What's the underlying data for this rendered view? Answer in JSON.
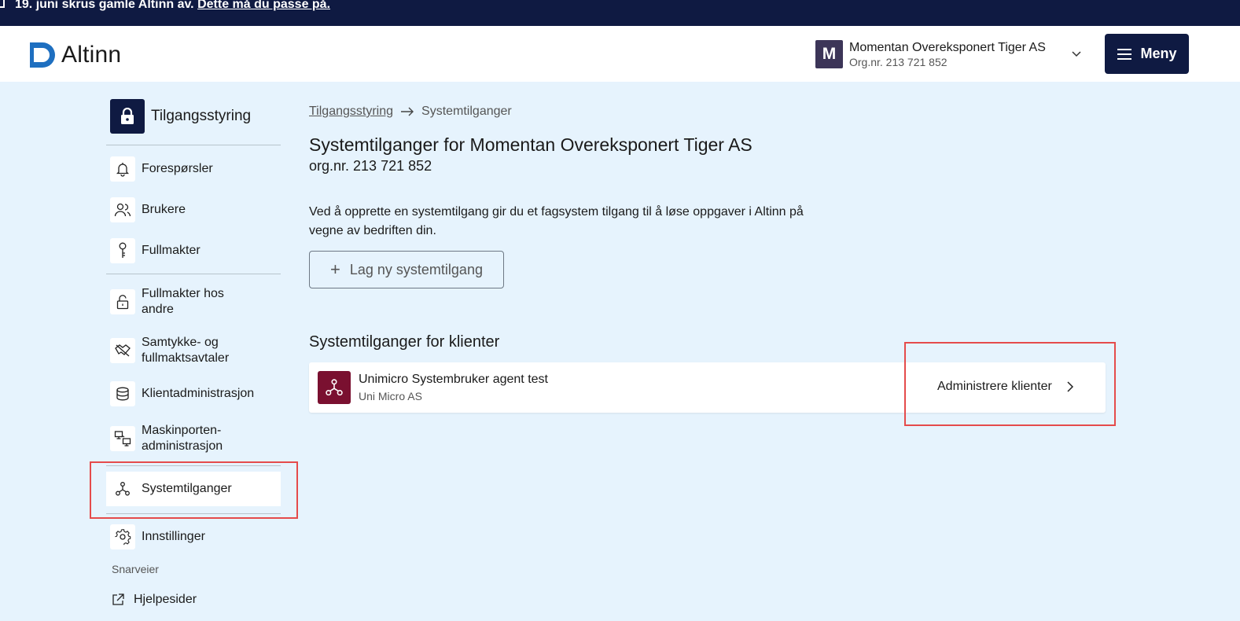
{
  "banner": {
    "text": "19. juni skrus gamle Altinn av.",
    "link": "Dette må du passe på."
  },
  "header": {
    "logo_text": "Altinn",
    "account": {
      "initial": "M",
      "name": "Momentan Overeksponert Tiger AS",
      "orgnr": "Org.nr. 213 721 852"
    },
    "menu_label": "Meny"
  },
  "sidebar": {
    "title": "Tilgangsstyring",
    "items": [
      {
        "label": "Forespørsler",
        "icon": "bell-icon"
      },
      {
        "label": "Brukere",
        "icon": "users-icon"
      },
      {
        "label": "Fullmakter",
        "icon": "key-icon"
      },
      {
        "label": "Fullmakter hos andre",
        "icon": "padlock-open-icon"
      },
      {
        "label": "Samtykke- og fullmaktsavtaler",
        "icon": "handshake-icon"
      },
      {
        "label": "Klientadministrasjon",
        "icon": "database-icon"
      },
      {
        "label": "Maskinporten-administrasjon",
        "icon": "monitors-icon"
      },
      {
        "label": "Systemtilganger",
        "icon": "network-icon",
        "active": true
      },
      {
        "label": "Innstillinger",
        "icon": "gear-icon"
      }
    ],
    "shortcuts_heading": "Snarveier",
    "shortcuts": [
      {
        "label": "Hjelpesider",
        "icon": "external-link-icon"
      }
    ]
  },
  "main": {
    "breadcrumb": {
      "parent": "Tilgangsstyring",
      "current": "Systemtilganger"
    },
    "title": "Systemtilganger for Momentan Overeksponert Tiger AS",
    "orgnr": "org.nr. 213 721 852",
    "description": "Ved å opprette en systemtilgang gir du et fagsystem tilgang til å løse oppgaver i Altinn på vegne av bedriften din.",
    "new_button": "Lag ny systemtilgang",
    "clients_heading": "Systemtilganger for klienter",
    "client_card": {
      "title": "Unimicro Systembruker agent test",
      "subtitle": "Uni Micro AS",
      "action": "Administrere klienter"
    }
  },
  "colors": {
    "navy": "#0f1a42",
    "background": "#e6f3fd",
    "card_icon": "#7a1030",
    "avatar": "#3c3558",
    "highlight": "#e54b4b"
  }
}
